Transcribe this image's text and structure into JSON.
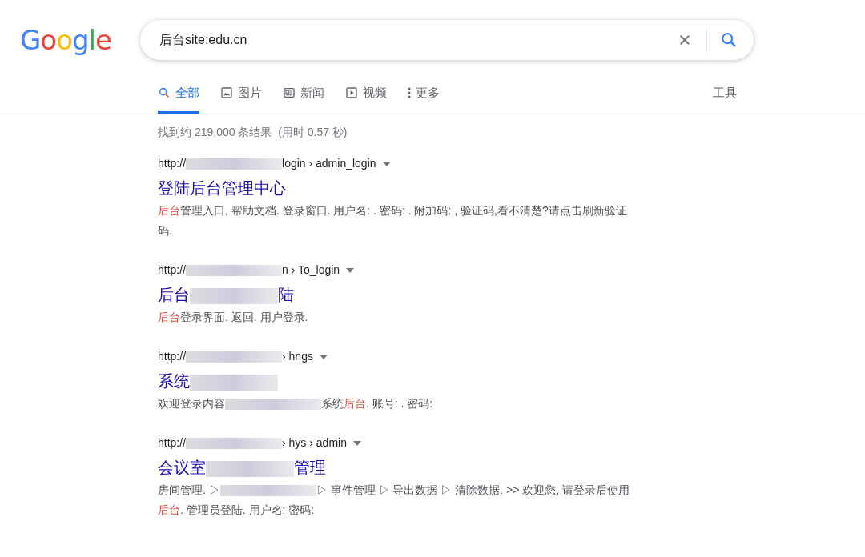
{
  "logo": {
    "letters": [
      {
        "char": "G",
        "color": "#4285f4"
      },
      {
        "char": "o",
        "color": "#ea4335"
      },
      {
        "char": "o",
        "color": "#fbbc05"
      },
      {
        "char": "g",
        "color": "#4285f4"
      },
      {
        "char": "l",
        "color": "#34a853"
      },
      {
        "char": "e",
        "color": "#ea4335"
      }
    ]
  },
  "search": {
    "value": "后台site:edu.cn"
  },
  "tabs": [
    {
      "label": "全部",
      "kind": "search",
      "selected": true
    },
    {
      "label": "图片",
      "kind": "image",
      "selected": false
    },
    {
      "label": "新闻",
      "kind": "news",
      "selected": false
    },
    {
      "label": "视频",
      "kind": "video",
      "selected": false
    },
    {
      "label": "更多",
      "kind": "more",
      "selected": false
    }
  ],
  "tools": "工具",
  "result_stats": "找到约 219,000 条结果  (用时 0.57 秒)",
  "results": [
    {
      "url": [
        {
          "kind": "text",
          "text": "http://"
        },
        {
          "kind": "blur"
        },
        {
          "kind": "text",
          "text": "login › admin_login"
        }
      ],
      "title": [
        {
          "kind": "text",
          "text": "登陆后台管理中心"
        }
      ],
      "snippet": [
        {
          "kind": "hl",
          "text": "后台"
        },
        {
          "kind": "text",
          "text": "管理入口, 帮助文档. 登录窗口. 用户名: . 密码: . 附加码: , 验证码,看不清楚?请点击刷新验证码."
        }
      ]
    },
    {
      "url": [
        {
          "kind": "text",
          "text": "http://"
        },
        {
          "kind": "blur"
        },
        {
          "kind": "text",
          "text": "n › To_login"
        }
      ],
      "title": [
        {
          "kind": "text",
          "text": "后台"
        },
        {
          "kind": "blur"
        },
        {
          "kind": "text",
          "text": "陆"
        }
      ],
      "snippet": [
        {
          "kind": "hl",
          "text": "后台"
        },
        {
          "kind": "text",
          "text": "登录界面. 返回. 用户登录."
        }
      ]
    },
    {
      "url": [
        {
          "kind": "text",
          "text": "http://"
        },
        {
          "kind": "blur"
        },
        {
          "kind": "text",
          "text": "› hngs"
        }
      ],
      "title": [
        {
          "kind": "text",
          "text": "系统"
        },
        {
          "kind": "blur"
        }
      ],
      "snippet": [
        {
          "kind": "text",
          "text": "欢迎登录内容"
        },
        {
          "kind": "blur"
        },
        {
          "kind": "text",
          "text": "系统"
        },
        {
          "kind": "hl",
          "text": "后台"
        },
        {
          "kind": "text",
          "text": ". 账号: . 密码:"
        }
      ]
    },
    {
      "url": [
        {
          "kind": "text",
          "text": "http://"
        },
        {
          "kind": "blur"
        },
        {
          "kind": "text",
          "text": "› hys › admin"
        }
      ],
      "title": [
        {
          "kind": "text",
          "text": "会议室"
        },
        {
          "kind": "blur"
        },
        {
          "kind": "text",
          "text": "管理"
        }
      ],
      "snippet": [
        {
          "kind": "text",
          "text": "房间管理. ▷"
        },
        {
          "kind": "blur"
        },
        {
          "kind": "text",
          "text": "▷ 事件管理 ▷ 导出数据 ▷ 清除数据. >> 欢迎您, 请登录后使用"
        },
        {
          "kind": "hl",
          "text": "后台"
        },
        {
          "kind": "text",
          "text": ". 管理员登陆. 用户名:  密码:"
        }
      ]
    }
  ]
}
